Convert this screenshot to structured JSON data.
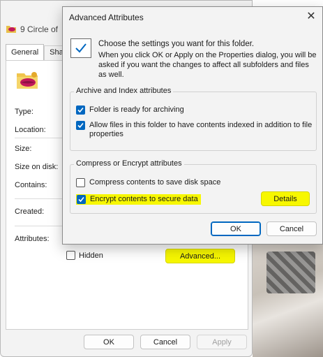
{
  "properties_window": {
    "title": "9 Circle of",
    "tabs": [
      "General",
      "Shari"
    ],
    "labels": {
      "type": "Type:",
      "location": "Location:",
      "size": "Size:",
      "size_on_disk": "Size on disk:",
      "contains": "Contains:",
      "created": "Created:",
      "attributes": "Attributes:"
    },
    "hidden_label": "Hidden",
    "hidden_checked": false,
    "advanced_button": "Advanced...",
    "ok_button": "OK",
    "cancel_button": "Cancel",
    "apply_button": "Apply"
  },
  "dialog": {
    "title": "Advanced Attributes",
    "intro_line1": "Choose the settings you want for this folder.",
    "intro_line2": "When you click OK or Apply on the Properties dialog, you will be asked if you want the changes to affect all subfolders and files as well.",
    "archive_group": {
      "label": "Archive and Index attributes",
      "archiving_label": "Folder is ready for archiving",
      "archiving_checked": true,
      "indexing_label": "Allow files in this folder to have contents indexed in addition to file properties",
      "indexing_checked": true
    },
    "compress_group": {
      "label": "Compress or Encrypt attributes",
      "compress_label": "Compress contents to save disk space",
      "compress_checked": false,
      "encrypt_label": "Encrypt contents to secure data",
      "encrypt_checked": true,
      "details_button": "Details"
    },
    "ok_button": "OK",
    "cancel_button": "Cancel",
    "close_glyph": "✕"
  },
  "colors": {
    "highlight": "#f7f700",
    "accent": "#0067c0"
  }
}
